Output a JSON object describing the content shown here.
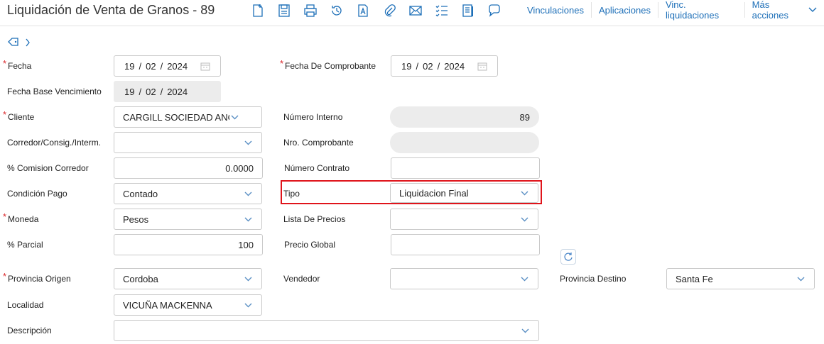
{
  "header": {
    "title": "Liquidación de Venta de Granos - 89",
    "links": [
      "Vinculaciones",
      "Aplicaciones",
      "Vinc. liquidaciones",
      "Más acciones"
    ]
  },
  "form": {
    "fecha": {
      "label": "Fecha",
      "day": "19",
      "month": "02",
      "year": "2024"
    },
    "fecha_comprobante": {
      "label": "Fecha De Comprobante",
      "day": "19",
      "month": "02",
      "year": "2024"
    },
    "fecha_base": {
      "label": "Fecha Base Vencimiento",
      "day": "19",
      "month": "02",
      "year": "2024"
    },
    "cliente": {
      "label": "Cliente",
      "value": "CARGILL SOCIEDAD ANONIMA"
    },
    "numero_interno": {
      "label": "Número Interno",
      "value": "89"
    },
    "corredor": {
      "label": "Corredor/Consig./Interm.",
      "value": ""
    },
    "nro_comprobante": {
      "label": "Nro. Comprobante",
      "value": ""
    },
    "comision": {
      "label": "% Comision Corredor",
      "value": "0.0000"
    },
    "numero_contrato": {
      "label": "Número Contrato",
      "value": ""
    },
    "condicion_pago": {
      "label": "Condición Pago",
      "value": "Contado"
    },
    "tipo": {
      "label": "Tipo",
      "value": "Liquidacion Final"
    },
    "moneda": {
      "label": "Moneda",
      "value": "Pesos"
    },
    "lista_precios": {
      "label": "Lista De Precios",
      "value": ""
    },
    "parcial": {
      "label": "% Parcial",
      "value": "100"
    },
    "precio_global": {
      "label": "Precio Global",
      "value": ""
    },
    "provincia_origen": {
      "label": "Provincia Origen",
      "value": "Cordoba"
    },
    "vendedor": {
      "label": "Vendedor",
      "value": ""
    },
    "provincia_destino": {
      "label": "Provincia Destino",
      "value": "Santa Fe"
    },
    "localidad": {
      "label": "Localidad",
      "value": "VICUÑA MACKENNA"
    },
    "descripcion": {
      "label": "Descripción",
      "value": ""
    }
  },
  "colors": {
    "accent": "#1d6fb8",
    "required": "#d9262a",
    "highlight": "#e0141b"
  }
}
